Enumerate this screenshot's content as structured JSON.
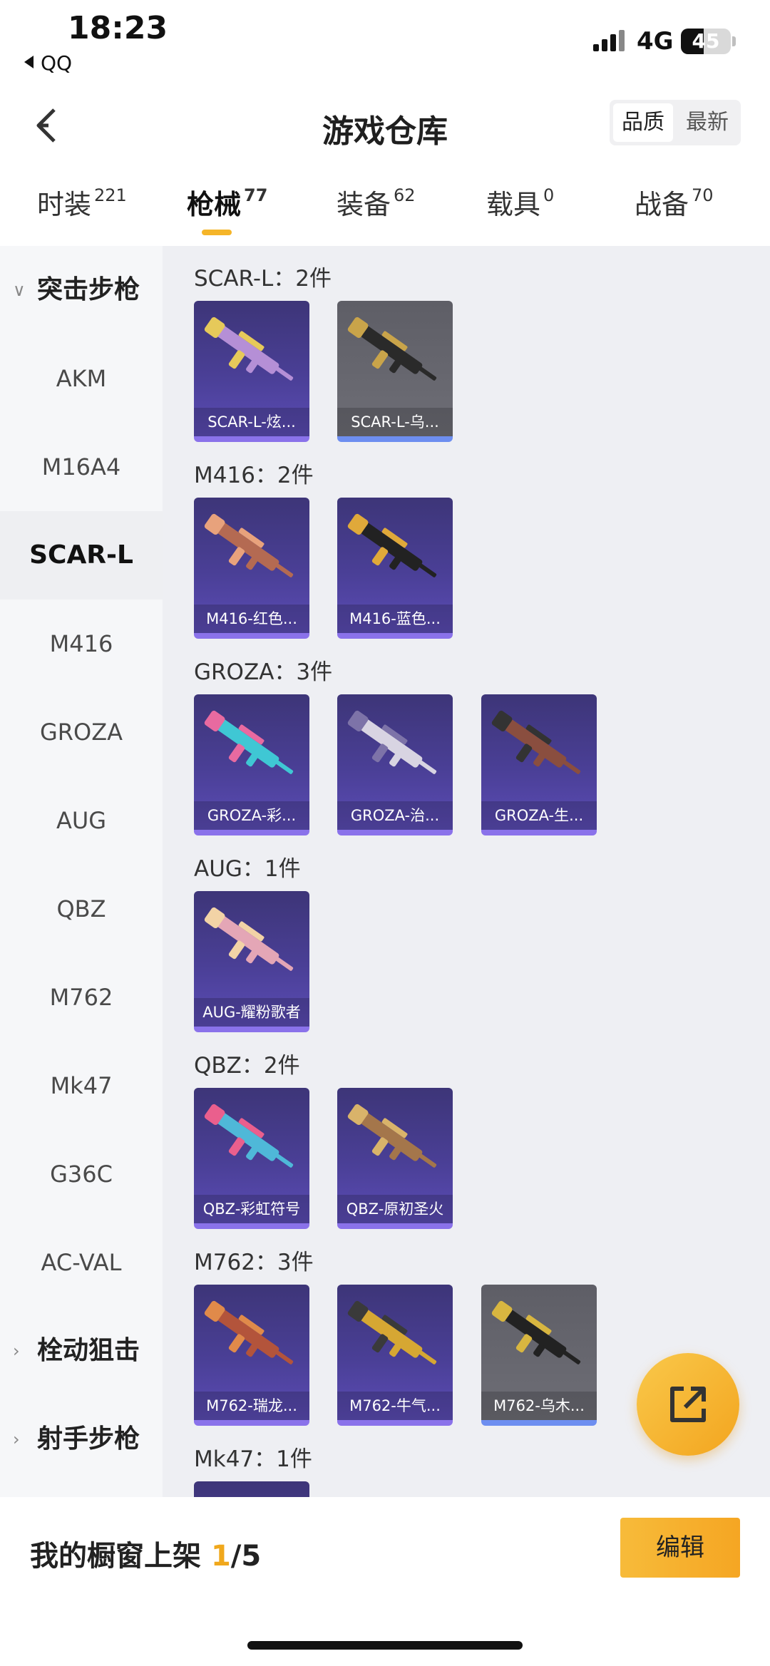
{
  "status": {
    "time": "18:23",
    "back_app": "QQ",
    "network": "4G",
    "battery": "45",
    "battery_level": 0.45
  },
  "header": {
    "title": "游戏仓库",
    "sort_options": [
      "品质",
      "最新"
    ]
  },
  "tabs": [
    {
      "label": "时装",
      "count": "221"
    },
    {
      "label": "枪械",
      "count": "77"
    },
    {
      "label": "装备",
      "count": "62"
    },
    {
      "label": "载具",
      "count": "0"
    },
    {
      "label": "战备",
      "count": "70"
    }
  ],
  "sidebar": {
    "group_assault": "突击步枪",
    "items": [
      "AKM",
      "M16A4",
      "SCAR-L",
      "M416",
      "GROZA",
      "AUG",
      "QBZ",
      "M762",
      "Mk47",
      "G36C",
      "AC-VAL"
    ],
    "group_bolt": "栓动狙击",
    "group_marksman": "射手步枪"
  },
  "sections": [
    {
      "title": "SCAR-L：2件",
      "items": [
        {
          "label": "SCAR-L-炫...",
          "bg": "purple",
          "gun": "#b58fd6",
          "accent": "#e6c95a"
        },
        {
          "label": "SCAR-L-乌...",
          "bg": "gray",
          "gun": "#2a2a2a",
          "accent": "#c9a44a"
        }
      ]
    },
    {
      "title": "M416：2件",
      "items": [
        {
          "label": "M416-红色...",
          "bg": "purple",
          "gun": "#b46a52",
          "accent": "#e8a27c"
        },
        {
          "label": "M416-蓝色...",
          "bg": "purple",
          "gun": "#222222",
          "accent": "#e0a93a"
        }
      ]
    },
    {
      "title": "GROZA：3件",
      "items": [
        {
          "label": "GROZA-彩...",
          "bg": "purple",
          "gun": "#3fc7d4",
          "accent": "#e86aa0"
        },
        {
          "label": "GROZA-治...",
          "bg": "purple",
          "gun": "#d8d4e2",
          "accent": "#7d73a8"
        },
        {
          "label": "GROZA-生...",
          "bg": "purple",
          "gun": "#8a4e3f",
          "accent": "#333333"
        }
      ]
    },
    {
      "title": "AUG：1件",
      "items": [
        {
          "label": "AUG-耀粉歌者",
          "bg": "purple",
          "gun": "#e4a6b6",
          "accent": "#f2d3a6"
        }
      ]
    },
    {
      "title": "QBZ：2件",
      "items": [
        {
          "label": "QBZ-彩虹符号",
          "bg": "purple",
          "gun": "#4fb8d8",
          "accent": "#ea5f8d"
        },
        {
          "label": "QBZ-原初圣火",
          "bg": "purple",
          "gun": "#a4764b",
          "accent": "#d9b36a"
        }
      ]
    },
    {
      "title": "M762：3件",
      "items": [
        {
          "label": "M762-瑞龙...",
          "bg": "purple",
          "gun": "#b3543b",
          "accent": "#e08a4a"
        },
        {
          "label": "M762-牛气...",
          "bg": "purple",
          "gun": "#d6a733",
          "accent": "#3a3a3a"
        },
        {
          "label": "M762-乌木...",
          "bg": "gray",
          "gun": "#222222",
          "accent": "#d8b640"
        }
      ]
    },
    {
      "title": "Mk47：1件",
      "items": [
        {
          "label": "",
          "bg": "purple",
          "gun": "#333333",
          "accent": "#777777"
        }
      ]
    }
  ],
  "bottom": {
    "prefix": "我的橱窗上架 ",
    "current": "1",
    "total": "/5",
    "edit_label": "编辑"
  },
  "colors": {
    "accent": "#f5b529",
    "card_purple": "#4a3f96",
    "card_gray": "#6e6e76",
    "main_bg": "#eeeff3"
  }
}
